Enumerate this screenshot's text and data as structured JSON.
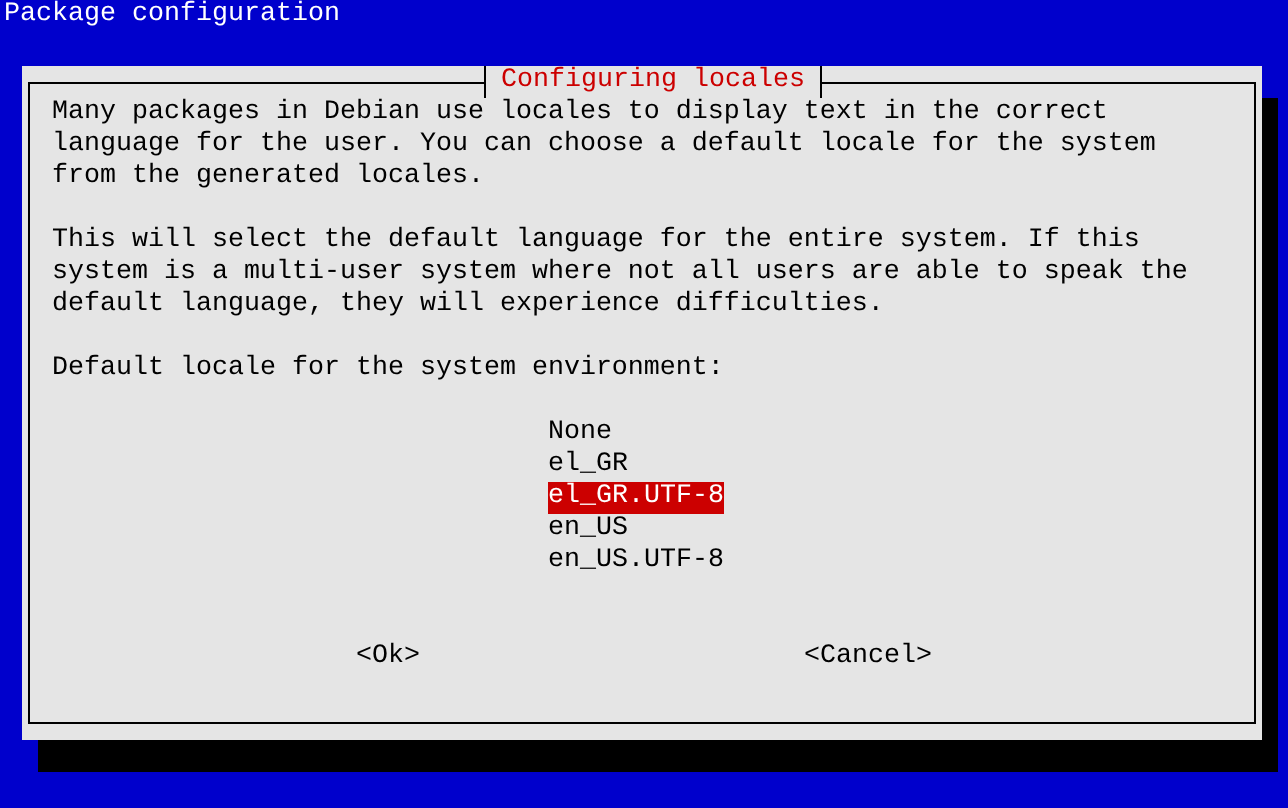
{
  "window": {
    "title": "Package configuration"
  },
  "dialog": {
    "title": "Configuring locales",
    "paragraphs": [
      "Many packages in Debian use locales to display text in the correct language for the user. You can choose a default locale for the system from the generated locales.",
      "This will select the default language for the entire system. If this system is a multi-user system where not all users are able to speak the default language, they will experience difficulties."
    ],
    "prompt": "Default locale for the system environment:",
    "options": [
      {
        "label": "None",
        "selected": false
      },
      {
        "label": "el_GR",
        "selected": false
      },
      {
        "label": "el_GR.UTF-8",
        "selected": true
      },
      {
        "label": "en_US",
        "selected": false
      },
      {
        "label": "en_US.UTF-8",
        "selected": false
      }
    ],
    "buttons": [
      "<Ok>",
      "<Cancel>"
    ]
  }
}
